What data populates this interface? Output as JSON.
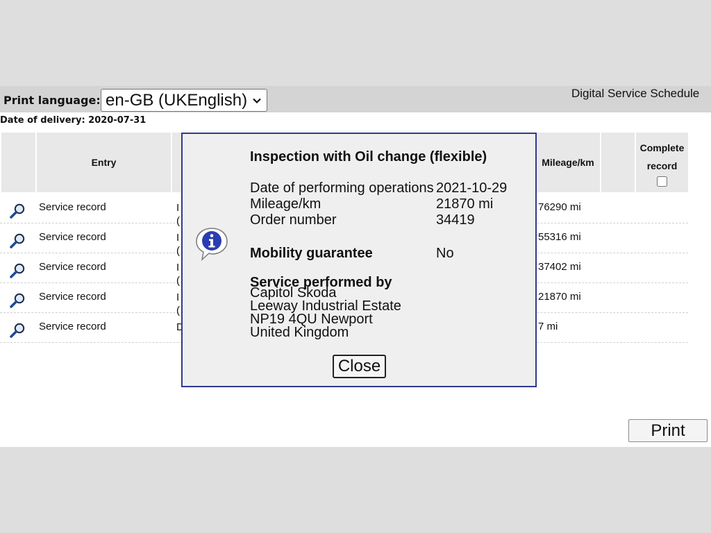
{
  "header": {
    "print_language_label": "Print language:",
    "print_language_value": "en-GB (UKEnglish)",
    "app_title": "Digital Service Schedule"
  },
  "delivery": "Date of delivery: 2020-07-31",
  "table": {
    "headers": {
      "entry": "Entry",
      "mileage": "Mileage/km",
      "complete_record_line1": "Complete",
      "complete_record_line2": "record"
    },
    "rows": [
      {
        "entry": "Service record",
        "clip": "I (",
        "mileage": "76290 mi"
      },
      {
        "entry": "Service record",
        "clip": "I (",
        "mileage": "55316 mi"
      },
      {
        "entry": "Service record",
        "clip": "I (",
        "mileage": "37402 mi"
      },
      {
        "entry": "Service record",
        "clip": "I (",
        "mileage": "21870 mi"
      },
      {
        "entry": "Service record",
        "clip": "D",
        "mileage": "7 mi"
      }
    ]
  },
  "print_button": "Print",
  "dialog": {
    "title": "Inspection with Oil change (flexible)",
    "date_label": "Date of performing operations",
    "date_value": "2021-10-29",
    "mileage_label": "Mileage/km",
    "mileage_value": "21870 mi",
    "order_label": "Order number",
    "order_value": "34419",
    "mobility_label": "Mobility guarantee",
    "mobility_value": "No",
    "service_heading": "Service performed by",
    "address": [
      "Capitol Skoda",
      "Leeway Industrial Estate",
      "NP19 4QU Newport",
      "United Kingdom"
    ],
    "close_label": "Close"
  },
  "icons": {
    "row_icon": "magnifier-icon",
    "dialog_icon": "info-icon"
  },
  "colors": {
    "dialog_border": "#2e3a8c",
    "info_blue": "#2a3db0",
    "magnifier_handle": "#1c4a99"
  }
}
